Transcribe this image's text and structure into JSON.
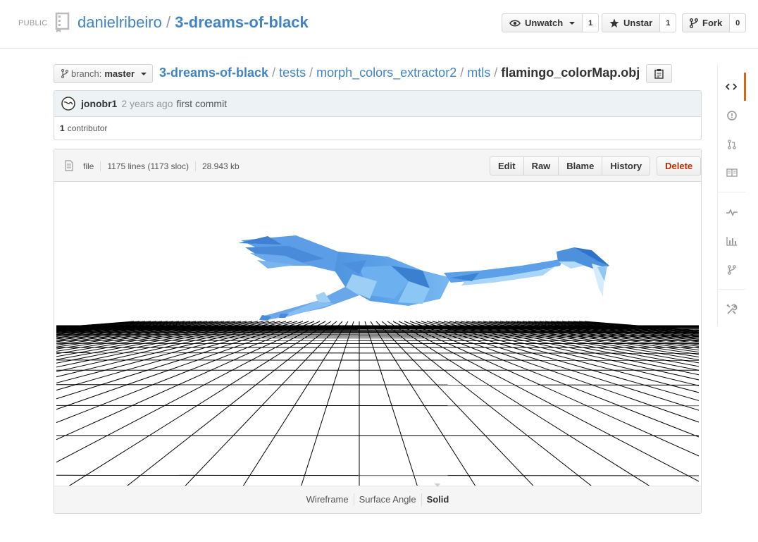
{
  "header": {
    "visibility_label": "PUBLIC",
    "owner": "danielribeiro",
    "separator": "/",
    "repo": "3-dreams-of-black"
  },
  "social": {
    "watch": {
      "label": "Unwatch",
      "count": "1"
    },
    "star": {
      "label": "Unstar",
      "count": "1"
    },
    "fork": {
      "label": "Fork",
      "count": "0"
    }
  },
  "sidebar": {
    "items": [
      {
        "icon": "code-icon",
        "selected": true
      },
      {
        "icon": "issue-icon"
      },
      {
        "icon": "pull-request-icon"
      },
      {
        "icon": "wiki-icon"
      },
      {
        "icon": "pulse-icon"
      },
      {
        "icon": "graphs-icon"
      },
      {
        "icon": "network-icon"
      },
      {
        "icon": "settings-icon"
      }
    ]
  },
  "branch": {
    "prefix": "branch:",
    "name": "master"
  },
  "breadcrumb": {
    "root": "3-dreams-of-black",
    "parts": [
      "tests",
      "morph_colors_extractor2",
      "mtls"
    ],
    "separator": "/",
    "final": "flamingo_colorMap.obj"
  },
  "commit": {
    "author": "jonobr1",
    "time": "2 years ago",
    "message": "first commit",
    "contributors_count": "1",
    "contributors_label": "contributor"
  },
  "file": {
    "type": "file",
    "lines": "1175 lines (1173 sloc)",
    "size": "28.943 kb",
    "actions": {
      "edit": "Edit",
      "raw": "Raw",
      "blame": "Blame",
      "history": "History",
      "delete": "Delete"
    }
  },
  "viewer": {
    "model_color": "#4a90d9",
    "modes": [
      "Wireframe",
      "Surface Angle",
      "Solid"
    ],
    "selected_mode": "Solid"
  },
  "colors": {
    "link": "#4183c4",
    "accent": "#d26911",
    "danger": "#bd2c00"
  }
}
